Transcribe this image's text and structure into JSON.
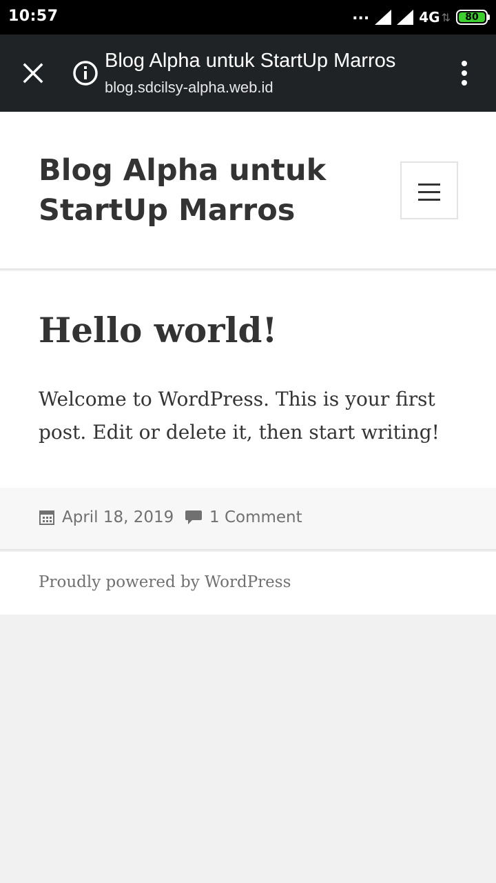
{
  "status_bar": {
    "time": "10:57",
    "dots": "...",
    "network": "4G",
    "battery": "80",
    "battery_color": "#3dcf2f"
  },
  "browser": {
    "page_title": "Blog Alpha untuk StartUp Marros",
    "url": "blog.sdcilsy-alpha.web.id",
    "close_icon": "close-icon",
    "info_icon": "info-icon",
    "menu_icon": "more-vert-icon"
  },
  "site": {
    "title": "Blog Alpha untuk StartUp Marros",
    "menu_icon": "hamburger-icon"
  },
  "post": {
    "title": "Hello world!",
    "body": "Welcome to WordPress. This is your first post. Edit or delete it, then start writing!",
    "date": "April 18, 2019",
    "comments": "1 Comment"
  },
  "footer": {
    "powered_by": "Proudly powered by WordPress"
  }
}
